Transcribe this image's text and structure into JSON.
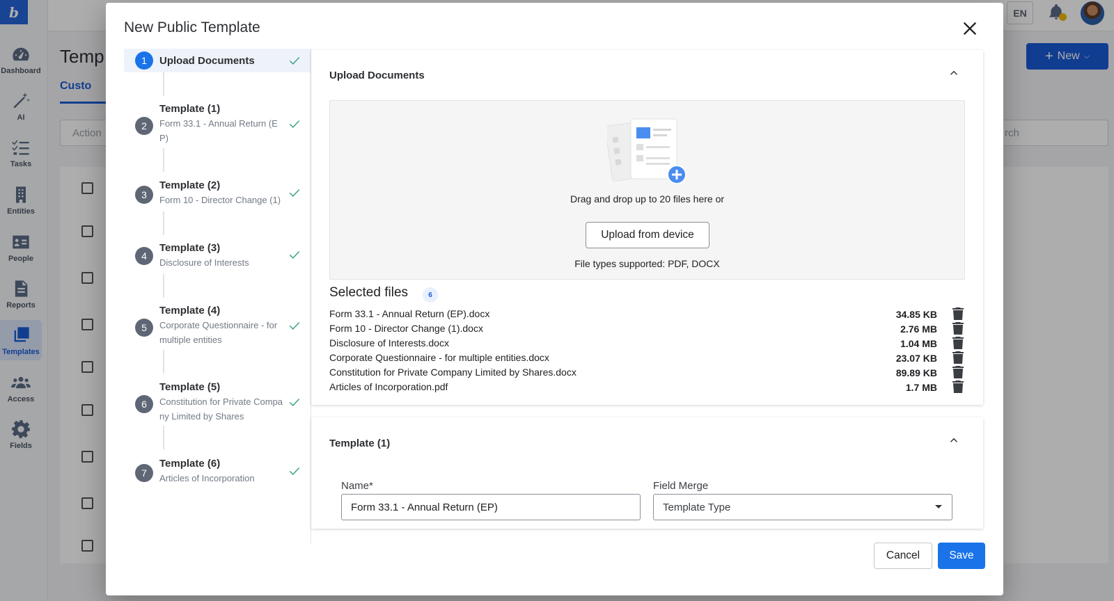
{
  "app": {
    "logo_text": "b",
    "nav": [
      {
        "label": "Dashboard",
        "icon": "gauge-icon"
      },
      {
        "label": "AI",
        "icon": "magic-wand-icon"
      },
      {
        "label": "Tasks",
        "icon": "checklist-icon"
      },
      {
        "label": "Entities",
        "icon": "building-icon"
      },
      {
        "label": "People",
        "icon": "id-card-icon"
      },
      {
        "label": "Reports",
        "icon": "document-icon"
      },
      {
        "label": "Templates",
        "icon": "stacked-pages-icon",
        "active": true
      },
      {
        "label": "Access",
        "icon": "users-icon"
      },
      {
        "label": "Fields",
        "icon": "gear-icon"
      }
    ],
    "language": "EN",
    "page_title": "Temp",
    "tab_label": "Custo",
    "actions_placeholder": "Action",
    "search_placeholder": "rch",
    "new_button": "New"
  },
  "modal": {
    "title": "New Public Template",
    "steps": [
      {
        "number": "1",
        "title": "Upload Documents",
        "subtitle": "",
        "done": true,
        "active": true
      },
      {
        "number": "2",
        "title": "Template (1)",
        "subtitle": "Form 33.1 - Annual Return (EP)",
        "done": true
      },
      {
        "number": "3",
        "title": "Template (2)",
        "subtitle": "Form 10 - Director Change (1)",
        "done": true
      },
      {
        "number": "4",
        "title": "Template (3)",
        "subtitle": "Disclosure of Interests",
        "done": true
      },
      {
        "number": "5",
        "title": "Template (4)",
        "subtitle": "Corporate Questionnaire - for multiple entities",
        "done": true
      },
      {
        "number": "6",
        "title": "Template (5)",
        "subtitle": "Constitution for Private Company Limited by Shares",
        "done": true
      },
      {
        "number": "7",
        "title": "Template (6)",
        "subtitle": "Articles of Incorporation",
        "done": true
      }
    ],
    "upload": {
      "heading": "Upload Documents",
      "drag_text": "Drag and drop up to 20 files here or",
      "upload_button": "Upload from device",
      "file_types": "File types supported: PDF, DOCX"
    },
    "selected": {
      "title": "Selected files",
      "count": "6",
      "files": [
        {
          "name": "Form 33.1 - Annual Return (EP).docx",
          "size": "34.85 KB"
        },
        {
          "name": "Form 10 - Director Change (1).docx",
          "size": "2.76 MB"
        },
        {
          "name": "Disclosure of Interests.docx",
          "size": "1.04 MB"
        },
        {
          "name": "Corporate Questionnaire - for multiple entities.docx",
          "size": "23.07 KB"
        },
        {
          "name": "Constitution for Private Company Limited by Shares.docx",
          "size": "89.89 KB"
        },
        {
          "name": "Articles of Incorporation.pdf",
          "size": "1.7 MB"
        }
      ]
    },
    "template_panel": {
      "heading": "Template (1)",
      "name_label": "Name",
      "name_required": "*",
      "name_value": "Form 33.1 - Annual Return (EP)",
      "field_merge_label": "Field Merge",
      "field_merge_value": "Template Type"
    },
    "cancel_button": "Cancel",
    "save_button": "Save"
  },
  "colors": {
    "primary": "#1a73e8",
    "check_green": "#3ea57a",
    "overlay": "rgba(0,0,0,0.32)"
  }
}
